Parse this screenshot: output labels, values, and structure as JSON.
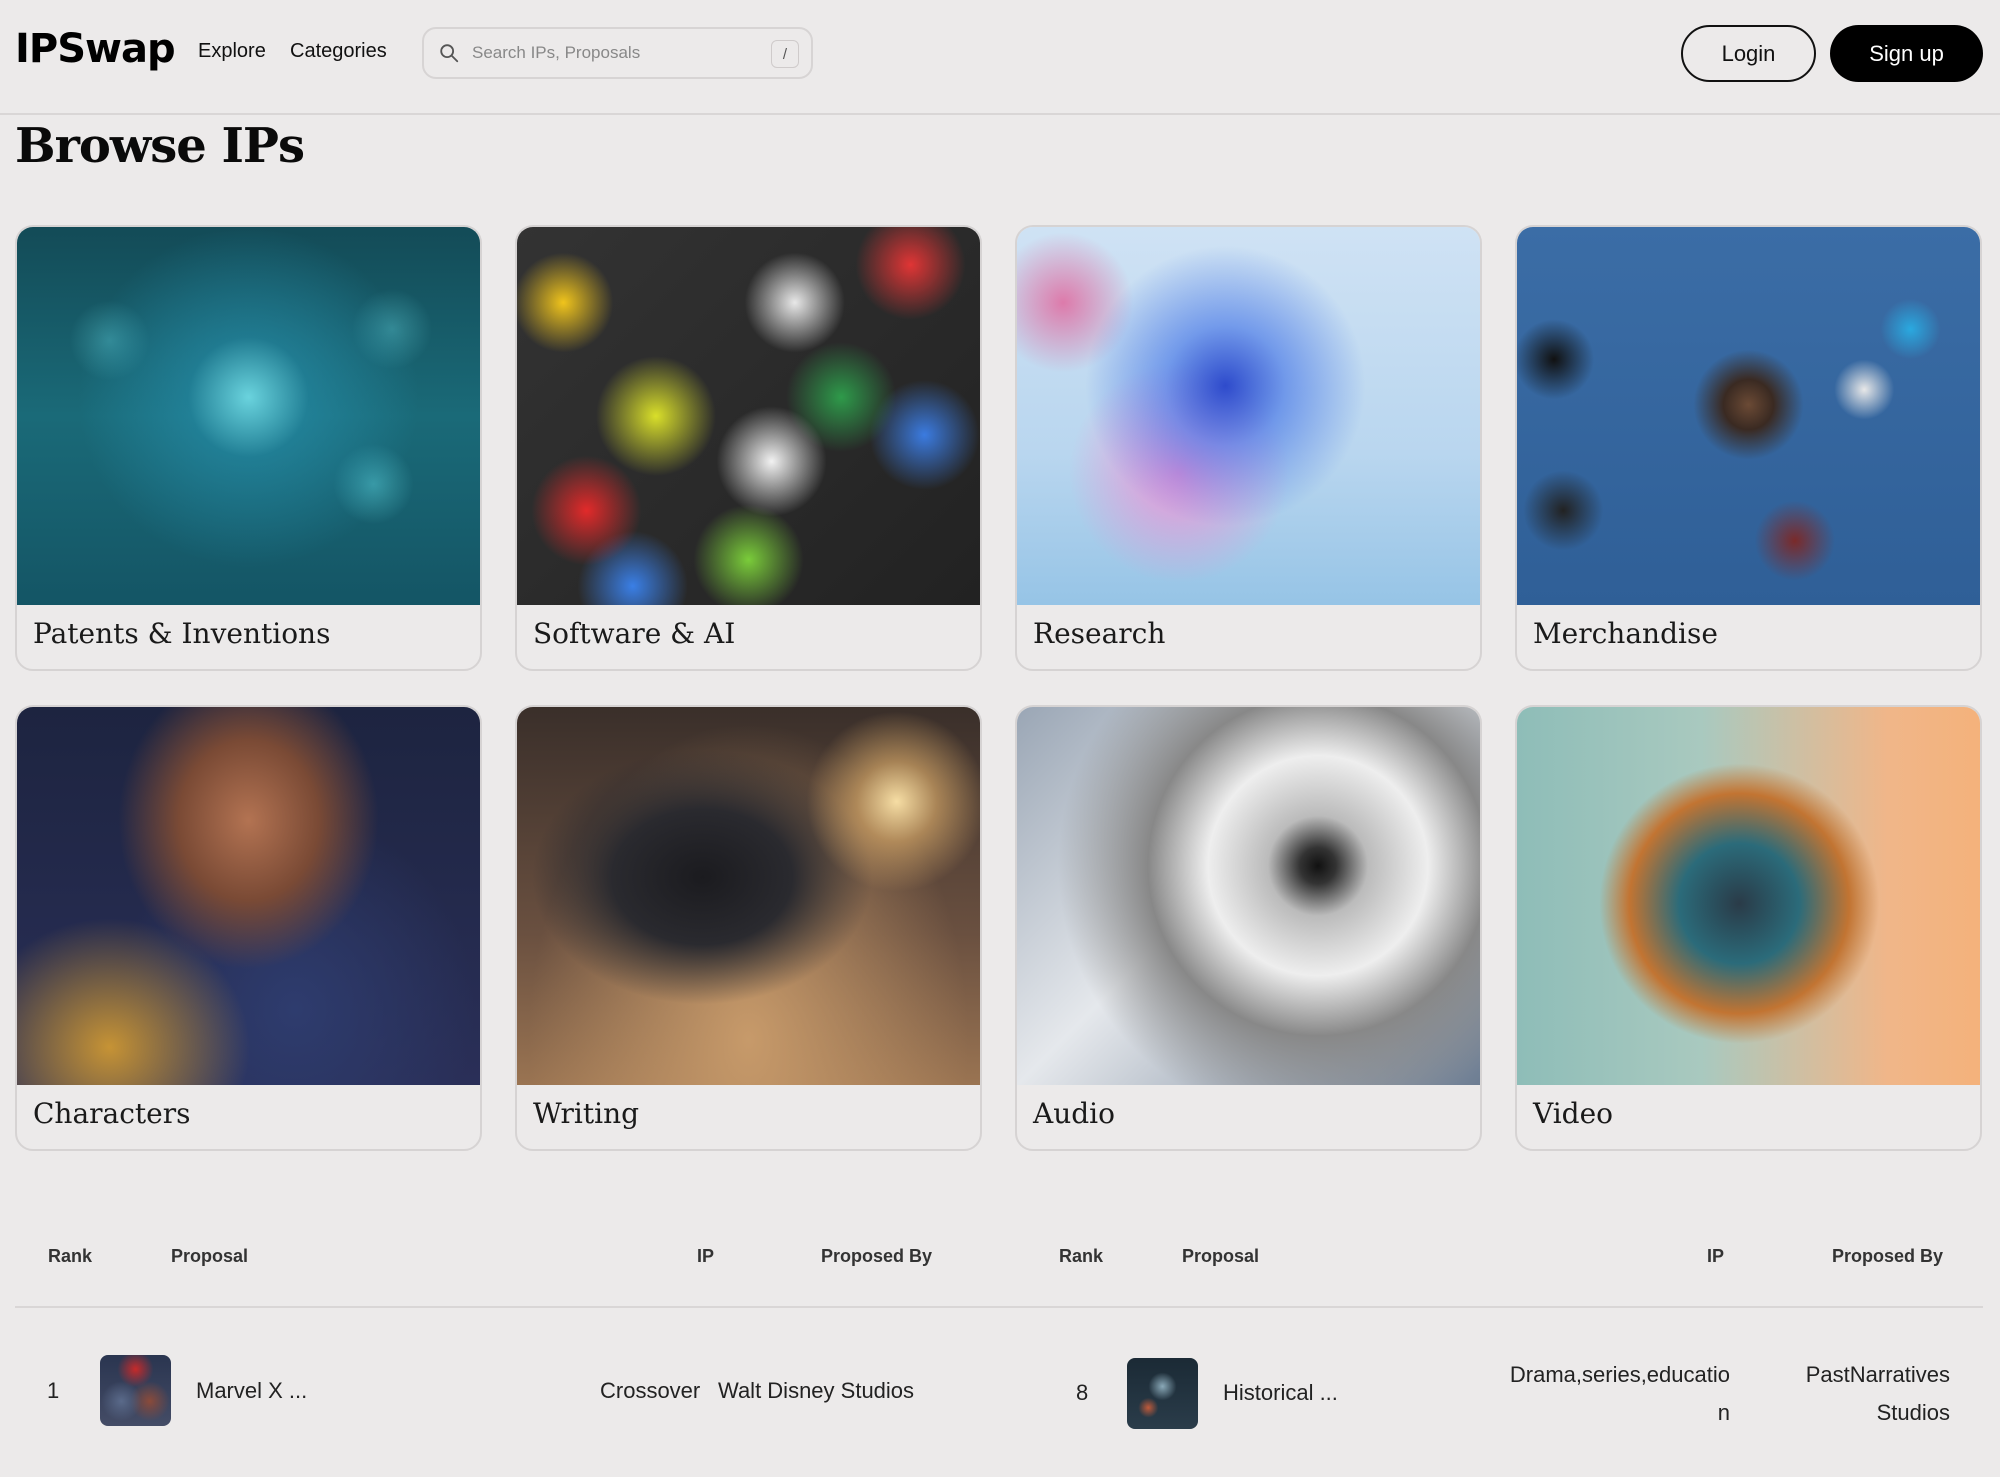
{
  "header": {
    "logo": "IPSwap",
    "nav": {
      "explore": "Explore",
      "categories": "Categories"
    },
    "search": {
      "placeholder": "Search IPs, Proposals",
      "shortcut": "/"
    },
    "login_label": "Login",
    "signup_label": "Sign up"
  },
  "page": {
    "title": "Browse IPs"
  },
  "categories": [
    {
      "label": "Patents & Inventions"
    },
    {
      "label": "Software & AI"
    },
    {
      "label": "Research"
    },
    {
      "label": "Merchandise"
    },
    {
      "label": "Characters"
    },
    {
      "label": "Writing"
    },
    {
      "label": "Audio"
    },
    {
      "label": "Video"
    }
  ],
  "table": {
    "columns": {
      "rank": "Rank",
      "proposal": "Proposal",
      "ip": "IP",
      "proposed_by": "Proposed By"
    },
    "left_row": {
      "rank": "1",
      "proposal": "Marvel X ...",
      "ip": "Crossover",
      "proposed_by": "Walt Disney Studios"
    },
    "right_row": {
      "rank": "8",
      "proposal": "Historical ...",
      "ip": "Drama,series,education",
      "proposed_by": "PastNarratives Studios"
    }
  }
}
